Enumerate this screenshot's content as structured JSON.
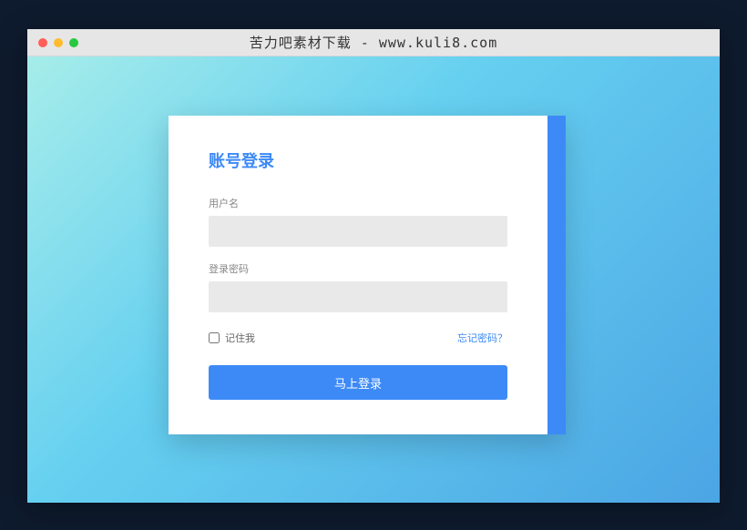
{
  "window": {
    "title": "苦力吧素材下载 - www.kuli8.com"
  },
  "login": {
    "heading": "账号登录",
    "username_label": "用户名",
    "password_label": "登录密码",
    "remember_label": "记住我",
    "forgot_label": "忘记密码？",
    "submit_label": "马上登录"
  },
  "colors": {
    "accent": "#3d8af7"
  }
}
